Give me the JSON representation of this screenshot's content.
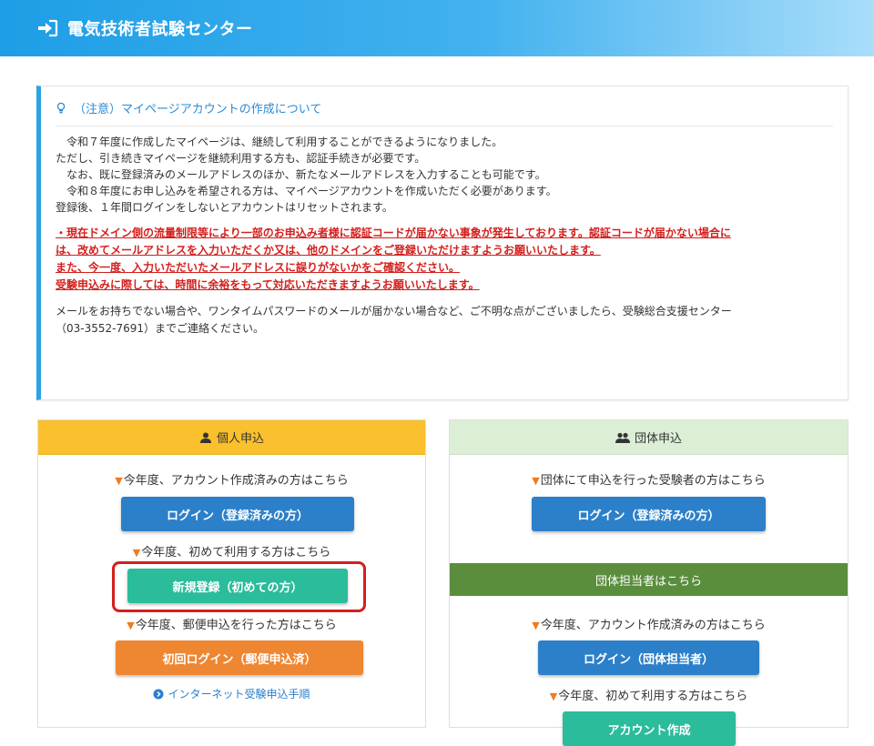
{
  "header": {
    "title": "電気技術者試験センター",
    "icon": "login-arrow-icon"
  },
  "notice": {
    "title": "（注意）マイページアカウントの作成について",
    "lines": [
      "令和７年度に作成したマイページは、継続して利用することができるようになりました。",
      "ただし、引き続きマイページを継続利用する方も、認証手続きが必要です。",
      "なお、既に登録済みのメールアドレスのほか、新たなメールアドレスを入力することも可能です。",
      "令和８年度にお申し込みを希望される方は、マイページアカウントを作成いただく必要があります。",
      "登録後、１年間ログインをしないとアカウントはリセットされます。"
    ],
    "warning_lines": [
      "・現在ドメイン側の流量制限等により一部のお申込み者様に認証コードが届かない事象が発生しております。認証コードが届かない場合に",
      "は、改めてメールアドレスを入力いただくか又は、他のドメインをご登録いただけますようお願いいたします。",
      "また、今一度、入力いただいたメールアドレスに誤りがないかをご確認ください。",
      "受験申込みに際しては、時間に余裕をもって対応いただきますようお願いいたします。"
    ],
    "contact_lines": [
      "メールをお持ちでない場合や、ワンタイムパスワードのメールが届かない場合など、ご不明な点がございましたら、受験総合支援センター",
      "（03-3552-7691）までご連絡ください。"
    ]
  },
  "individual": {
    "title": "個人申込",
    "note_existing": "今年度、アカウント作成済みの方はこちら",
    "login_button": "ログイン（登録済みの方）",
    "note_first": "今年度、初めて利用する方はこちら",
    "register_button": "新規登録（初めての方）",
    "note_postal": "今年度、郵便申込を行った方はこちら",
    "first_login_button": "初回ログイン（郵便申込済）",
    "procedure_link": "インターネット受験申込手順"
  },
  "group": {
    "title": "団体申込",
    "note_examinee": "団体にて申込を行った受験者の方はこちら",
    "login_button": "ログイン（登録済みの方）",
    "manager_bar": "団体担当者はこちら",
    "note_existing": "今年度、アカウント作成済みの方はこちら",
    "manager_login_button": "ログイン（団体担当者）",
    "note_first": "今年度、初めて利用する方はこちら",
    "create_account_button": "アカウント作成"
  },
  "triangle": "▼",
  "colors": {
    "header": "#1e9ee6",
    "notice_accent": "#2aa3e5",
    "individual_header": "#fbc02d",
    "group_header": "#dcefd6",
    "group_manager_bar": "#5a8e3c",
    "button_blue": "#2c80c9",
    "button_green": "#2bbc9b",
    "button_orange": "#ef8631",
    "warning_text": "#d3201d",
    "highlight_border": "#d61e1e"
  }
}
